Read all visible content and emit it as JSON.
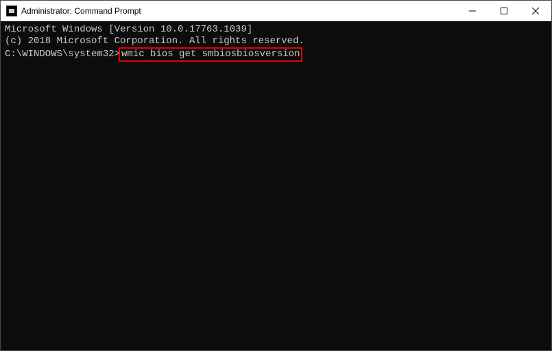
{
  "window": {
    "title": "Administrator: Command Prompt"
  },
  "terminal": {
    "line1": "Microsoft Windows [Version 10.0.17763.1039]",
    "line2": "(c) 2018 Microsoft Corporation. All rights reserved.",
    "blank": "",
    "prompt": "C:\\WINDOWS\\system32>",
    "command": "wmic bios get smbiosbiosversion"
  }
}
